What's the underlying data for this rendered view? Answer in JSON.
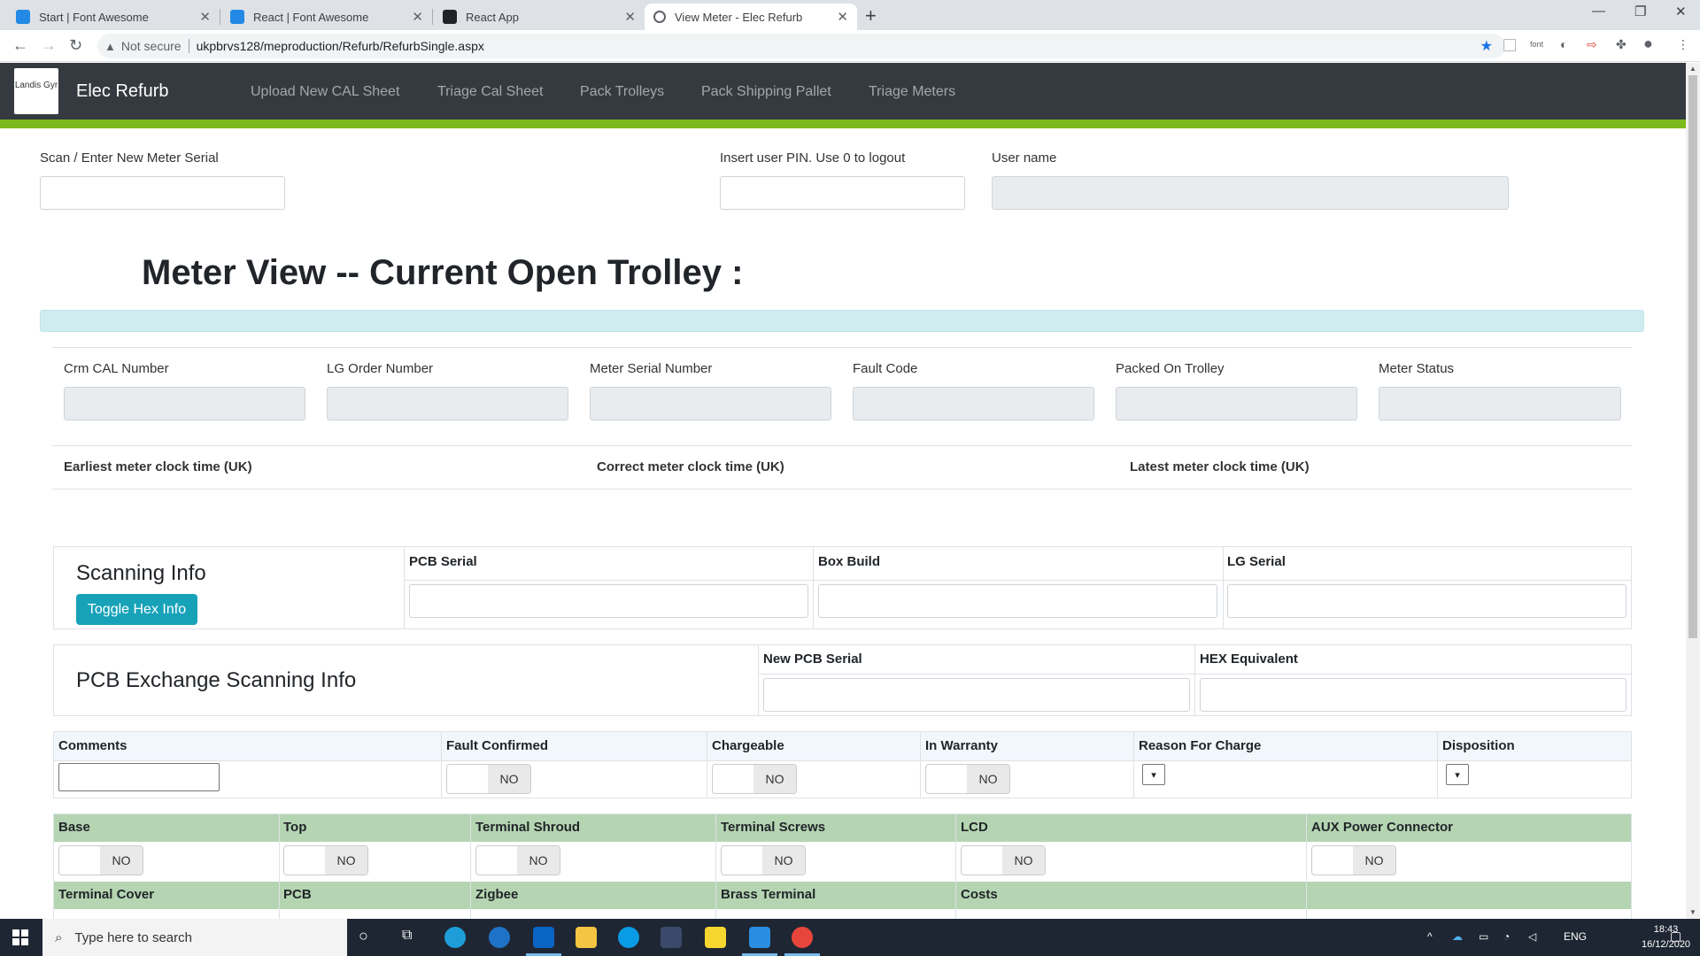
{
  "browser": {
    "tabs": [
      {
        "title": "Start | Font Awesome"
      },
      {
        "title": "React | Font Awesome"
      },
      {
        "title": "React App"
      },
      {
        "title": "View Meter - Elec Refurb"
      }
    ],
    "security_label": "Not secure",
    "url": "ukpbrvs128/meproduction/Refurb/RefurbSingle.aspx",
    "ext_font_label": "font"
  },
  "app": {
    "logo_text": "Landis Gyr",
    "brand": "Elec Refurb",
    "nav": [
      "Upload New CAL Sheet",
      "Triage Cal Sheet",
      "Pack Trolleys",
      "Pack Shipping Pallet",
      "Triage Meters"
    ]
  },
  "top_form": {
    "scan_label": "Scan / Enter New Meter Serial",
    "pin_label": "Insert user PIN. Use 0 to logout",
    "username_label": "User name"
  },
  "heading": "Meter View -- Current Open Trolley :",
  "meter_fields": [
    "Crm CAL Number",
    "LG Order Number",
    "Meter Serial Number",
    "Fault Code",
    "Packed On Trolley",
    "Meter Status"
  ],
  "clock_labels": [
    "Earliest meter clock time (UK)",
    "Correct meter clock time (UK)",
    "Latest meter clock time (UK)"
  ],
  "scanning": {
    "title": "Scanning Info",
    "toggle_button": "Toggle Hex Info",
    "headers": [
      "PCB Serial",
      "Box Build",
      "LG Serial"
    ]
  },
  "pcb_exchange": {
    "title": "PCB Exchange Scanning Info",
    "headers": [
      "New PCB Serial",
      "HEX Equivalent"
    ]
  },
  "charge_row": {
    "headers": [
      "Comments",
      "Fault Confirmed",
      "Chargeable",
      "In Warranty",
      "Reason For Charge",
      "Disposition"
    ],
    "toggle_value": "NO"
  },
  "parts_row1": {
    "headers": [
      "Base",
      "Top",
      "Terminal Shroud",
      "Terminal Screws",
      "LCD",
      "AUX Power Connector"
    ],
    "toggle_value": "NO"
  },
  "parts_row2": {
    "headers": [
      "Terminal Cover",
      "PCB",
      "Zigbee",
      "Brass Terminal",
      "Costs",
      ""
    ]
  },
  "taskbar": {
    "search_placeholder": "Type here to search",
    "language": "ENG",
    "time": "18:43",
    "date": "16/12/2020"
  },
  "colors": {
    "navbar": "#343a40",
    "accent_green": "#7cb91f",
    "info_button": "#17a2b8",
    "parts_header": "#b5d5b2",
    "alert_bar": "#d1ecf1"
  }
}
